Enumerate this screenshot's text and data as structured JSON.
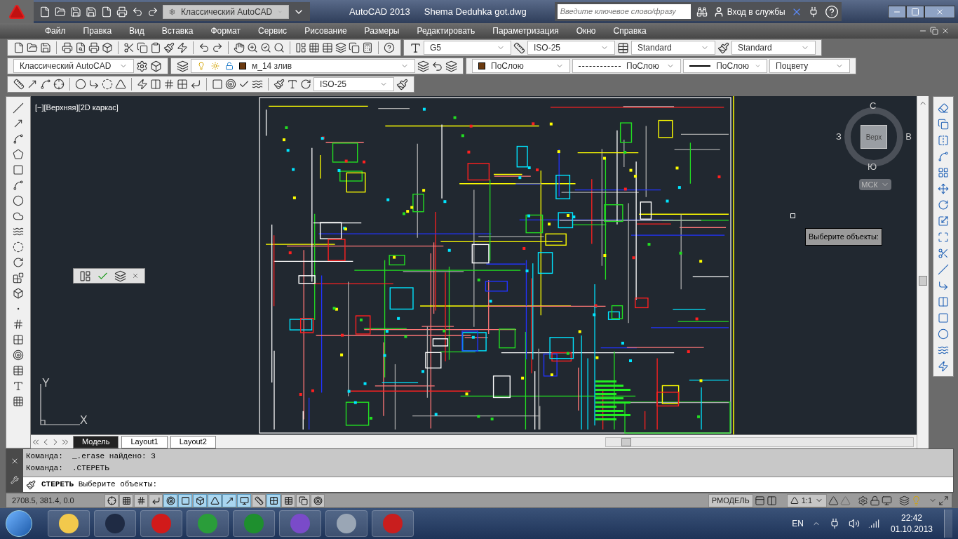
{
  "title_bar": {
    "workspace": "Классический AutoCAD",
    "app_title": "AutoCAD 2013",
    "file_name": "Shema Deduhka got.dwg",
    "search": {
      "placeholder": "Введите ключевое слово/фразу"
    },
    "sign_in": "Вход в службы"
  },
  "menu": [
    "Файл",
    "Правка",
    "Вид",
    "Вставка",
    "Формат",
    "Сервис",
    "Рисование",
    "Размеры",
    "Редактировать",
    "Параметризация",
    "Окно",
    "Справка"
  ],
  "toolbar_1": {
    "text_style": "G5",
    "dim_style": "ISO-25",
    "table_style": "Standard",
    "multileader_style": "Standard"
  },
  "toolbar_2": {
    "workspace": "Классический AutoCAD",
    "layer": "м_14 злив",
    "color_setting": "ПоСлою",
    "linetype": "ПоСлою",
    "lineweight": "ПоСлою",
    "plot_style": "Поцвету"
  },
  "toolbar_3": {
    "dim_style": "ISO-25"
  },
  "viewport": {
    "label": "[−][Верхняя][2D каркас]",
    "viewcube": {
      "north": "С",
      "west": "З",
      "east": "В",
      "south": "Ю",
      "face": "Верх",
      "ucs_menu": "МСК"
    },
    "tooltip": "Выберите объекты:",
    "ucs_axes": {
      "y": "Y",
      "x": "X"
    }
  },
  "layout_tabs": [
    {
      "label": "Модель",
      "selected": true
    },
    {
      "label": "Layout1",
      "selected": false
    },
    {
      "label": "Layout2",
      "selected": false
    }
  ],
  "command_history": [
    "Команда:  _.erase найдено: 3",
    "Команда:  .СТЕРЕТЬ"
  ],
  "command_prompt": "**СТЕРЕТЬ** Выберите объекты:",
  "status_bar": {
    "coordinates": "2708.5, 381.4, 0.0",
    "toggles": [
      {
        "on": false
      },
      {
        "on": false
      },
      {
        "on": false
      },
      {
        "on": false
      },
      {
        "on": true
      },
      {
        "on": true
      },
      {
        "on": true
      },
      {
        "on": true
      },
      {
        "on": true
      },
      {
        "on": true
      },
      {
        "on": false
      },
      {
        "on": true
      },
      {
        "on": false
      },
      {
        "on": false
      },
      {
        "on": false
      }
    ],
    "space": "РМОДЕЛЬ",
    "scale": "1:1"
  },
  "taskbar": {
    "language": "EN",
    "time": "22:42",
    "date": "01.10.2013"
  }
}
